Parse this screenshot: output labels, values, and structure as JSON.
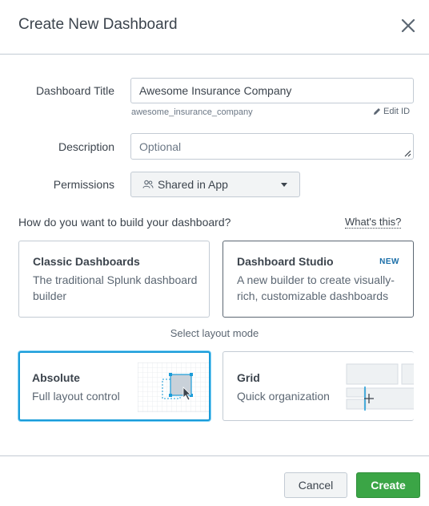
{
  "dialog": {
    "title": "Create New Dashboard"
  },
  "form": {
    "title_label": "Dashboard Title",
    "title_value": "Awesome Insurance Company",
    "dashboard_id": "awesome_insurance_company",
    "edit_id_label": "Edit ID",
    "description_label": "Description",
    "description_placeholder": "Optional",
    "permissions_label": "Permissions",
    "permissions_value": "Shared in App"
  },
  "build": {
    "question": "How do you want to build your dashboard?",
    "help_link": "What's this?",
    "options": [
      {
        "title": "Classic Dashboards",
        "description": "The traditional Splunk dashboard builder"
      },
      {
        "title": "Dashboard Studio",
        "badge": "NEW",
        "description": "A new builder to create visually-rich, customizable dashboards"
      }
    ]
  },
  "layout": {
    "label": "Select layout mode",
    "options": [
      {
        "title": "Absolute",
        "description": "Full layout control"
      },
      {
        "title": "Grid",
        "description": "Quick organization"
      }
    ]
  },
  "footer": {
    "cancel_label": "Cancel",
    "create_label": "Create"
  },
  "colors": {
    "primary": "#3ba546",
    "selected_border": "#1a9cd9",
    "text": "#3c444d"
  },
  "icons": {
    "close": "close-icon",
    "pencil": "pencil-icon",
    "users": "users-icon",
    "caret": "caret-down-icon"
  }
}
